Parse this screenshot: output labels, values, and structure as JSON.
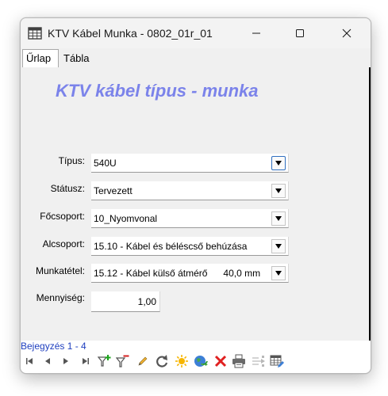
{
  "window": {
    "title": "KTV Kábel Munka - 0802_01r_01",
    "icon": "table-window-icon",
    "controls": [
      "minimize-icon",
      "maximize-icon",
      "close-icon"
    ]
  },
  "tabs": [
    {
      "label": "Űrlap",
      "active": true
    },
    {
      "label": "Tábla",
      "active": false
    }
  ],
  "form": {
    "heading": "KTV kábel típus - munka",
    "fields": [
      {
        "label": "Típus:",
        "value": "540U"
      },
      {
        "label": "Státusz:",
        "value": "Tervezett"
      },
      {
        "label": "Főcsoport:",
        "value": "10_Nyomvonal"
      },
      {
        "label": "Alcsoport:",
        "value": "15.10 - Kábel és béléscső behúzása"
      },
      {
        "label": "Munkatétel:",
        "value": "15.12 - Kábel külső átmérő      40,0 mm"
      },
      {
        "label": "Mennyiség:",
        "value": "1,00"
      }
    ]
  },
  "navigator": {
    "record_status": "Bejegyzés 1 - 4",
    "tools": [
      "first-record-icon",
      "previous-record-icon",
      "next-record-icon",
      "last-record-icon",
      "add-filter-icon",
      "remove-filter-icon",
      "edit-pencil-icon",
      "refresh-icon",
      "new-record-icon",
      "globe-icon",
      "delete-icon",
      "print-icon",
      "export-icon",
      "table-edit-icon"
    ]
  },
  "colors": {
    "heading": "#7b83ea",
    "record_status": "#1f3fbf",
    "focus_border": "#2f6fc0"
  }
}
